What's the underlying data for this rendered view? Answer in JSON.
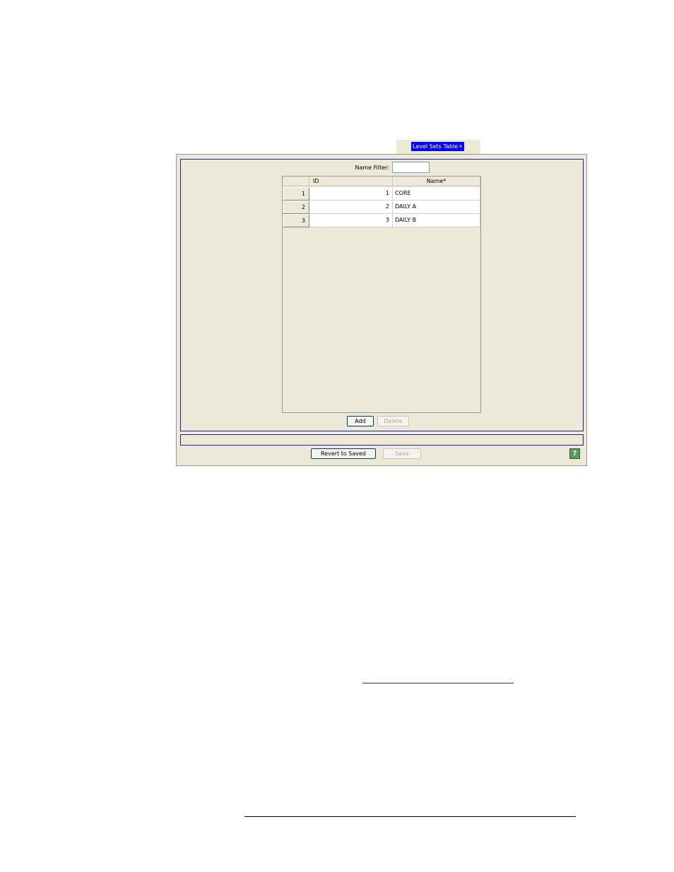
{
  "tab": {
    "label": "Level Sets Table",
    "close_label": "x"
  },
  "filter": {
    "label": "Name Filter:",
    "value": "",
    "placeholder": ""
  },
  "table": {
    "columns": [
      "",
      "ID",
      "Name*"
    ],
    "rows": [
      {
        "index": "1",
        "id": "1",
        "name": "CORE"
      },
      {
        "index": "2",
        "id": "2",
        "name": "DAILY A"
      },
      {
        "index": "3",
        "id": "3",
        "name": "DAILY B"
      }
    ]
  },
  "buttons": {
    "add": "Add",
    "delete": "Delete",
    "revert": "Revert to Saved",
    "save": "Save",
    "help": "?"
  },
  "status": {
    "text": ""
  },
  "colors": {
    "tab_active": "#0000ff",
    "panel_bg": "#ece9d8",
    "panel_border": "#2020a0"
  },
  "icons": {
    "help": "help-icon",
    "tab_close": "close-icon"
  }
}
